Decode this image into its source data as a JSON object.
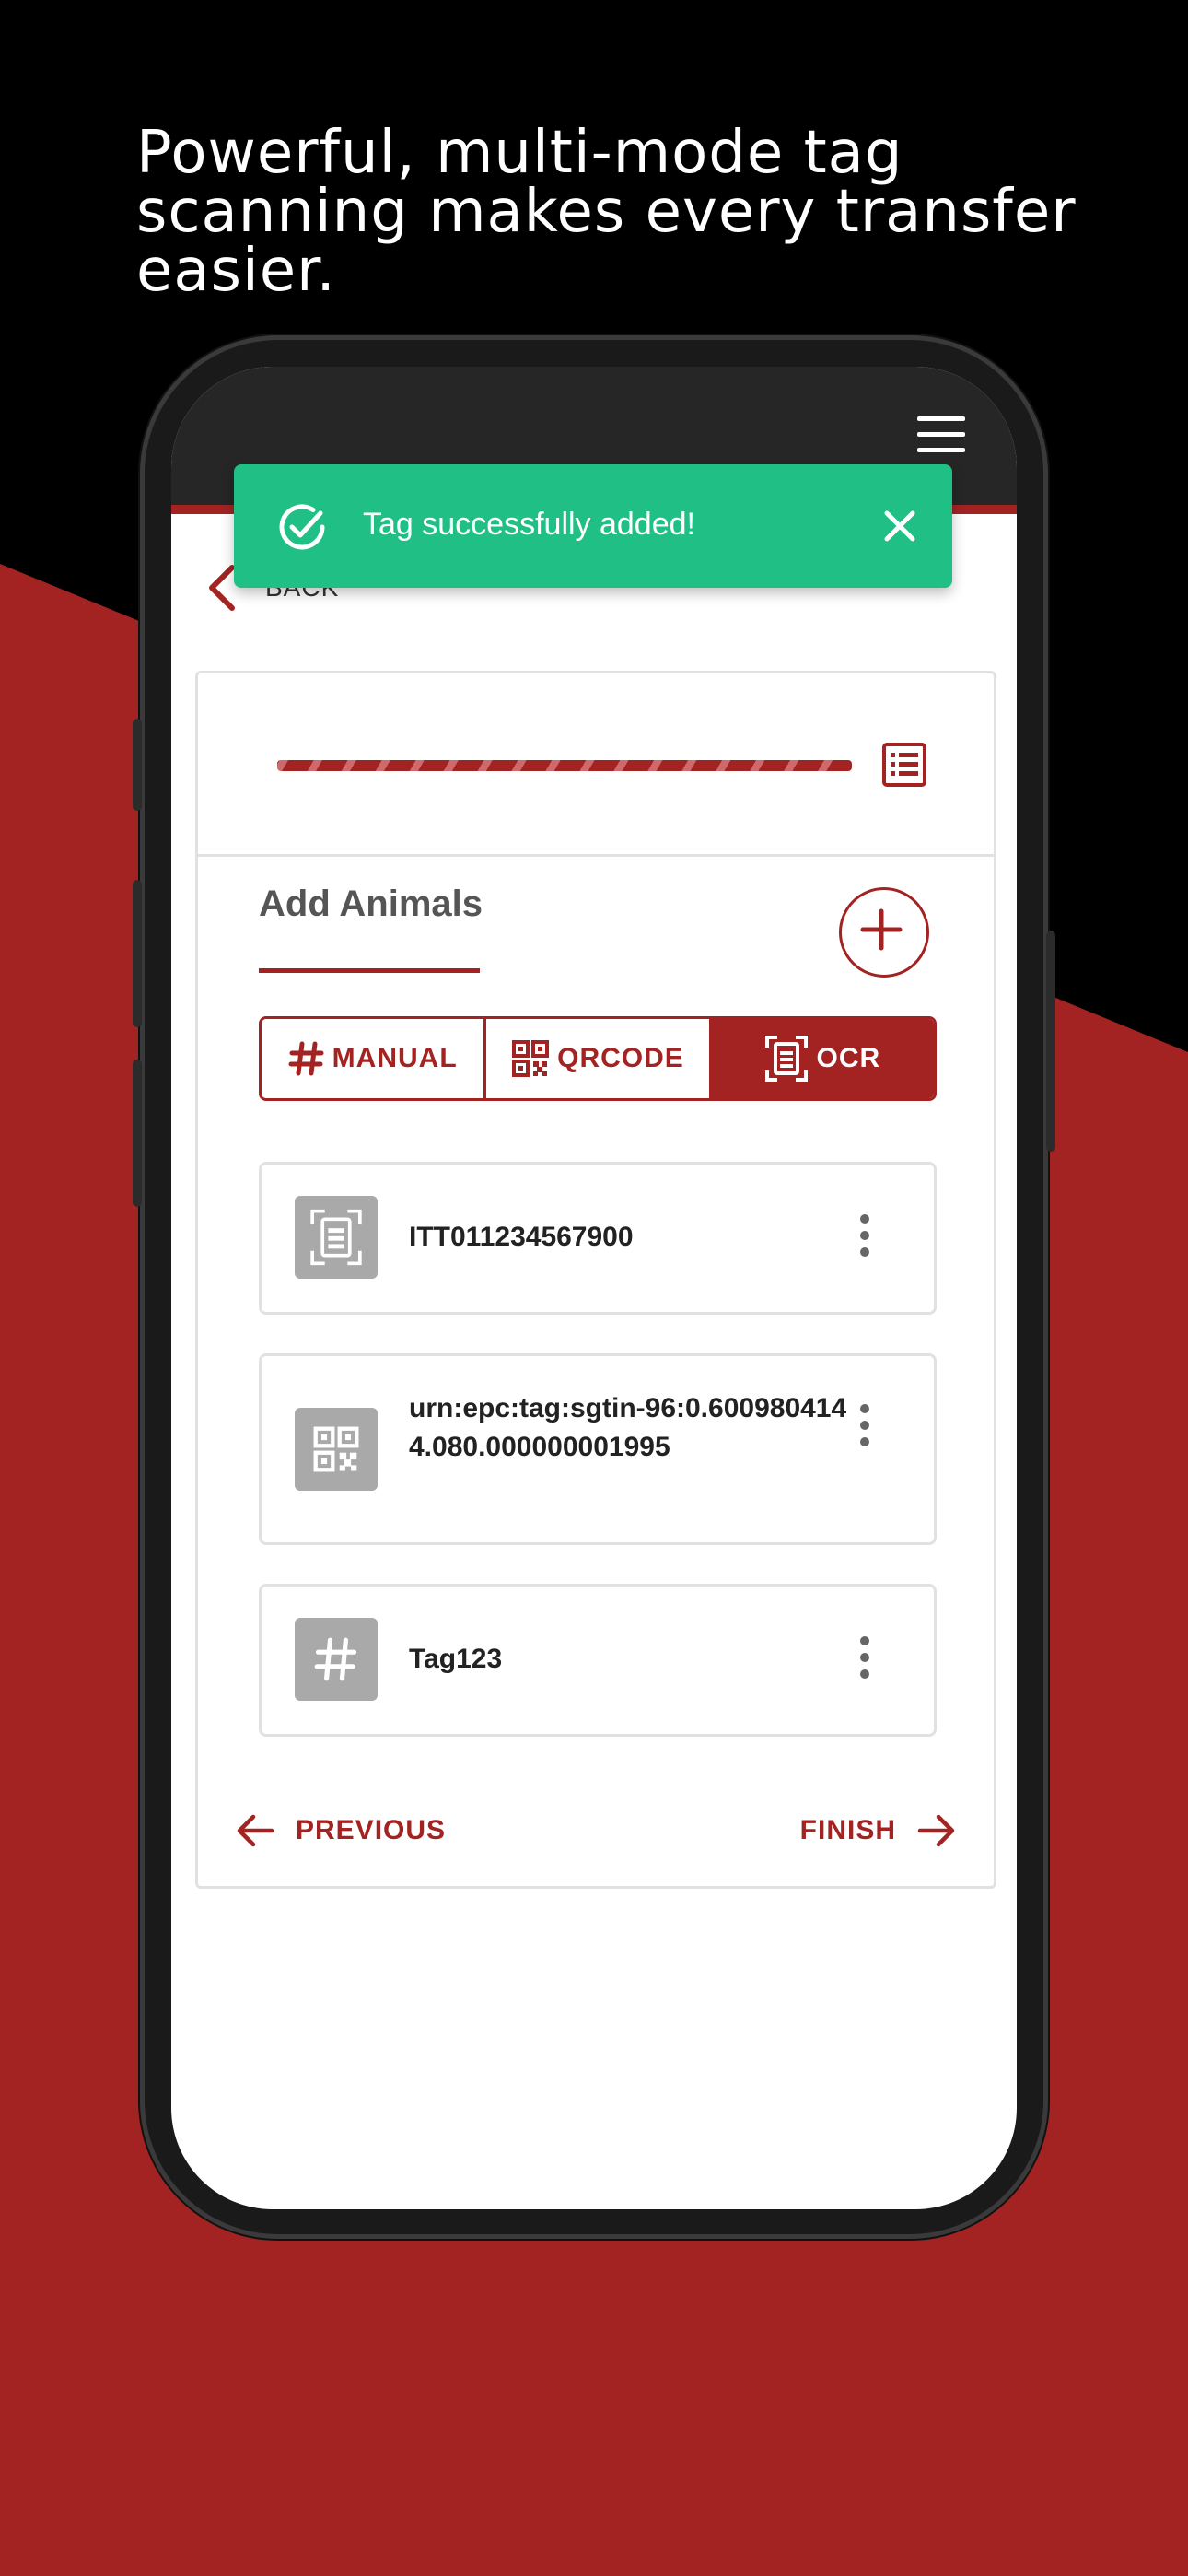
{
  "headline": "Powerful, multi-mode tag scanning makes every transfer easier.",
  "colors": {
    "brand_red": "#a32323",
    "toast_green": "#1fbf86",
    "appbar_dark": "#262626",
    "background_black": "#000000"
  },
  "appbar": {
    "menu_icon": "hamburger-menu-icon"
  },
  "back": {
    "label": "BACK"
  },
  "toast": {
    "message": "Tag successfully added!",
    "icon": "check-circle-icon",
    "close_icon": "close-icon"
  },
  "progress": {
    "icon": "list-icon"
  },
  "section": {
    "title": "Add Animals",
    "add_icon": "plus-icon"
  },
  "modes": [
    {
      "label": "MANUAL",
      "icon": "hash-icon",
      "active": false
    },
    {
      "label": "QRCODE",
      "icon": "qrcode-icon",
      "active": false
    },
    {
      "label": "OCR",
      "icon": "ocr-scan-icon",
      "active": true
    }
  ],
  "tags": [
    {
      "value": "ITT011234567900",
      "type_icon": "ocr-scan-icon"
    },
    {
      "value": "urn:epc:tag:sgtin-96:0.6009804144.080.000000001995",
      "type_icon": "qrcode-icon"
    },
    {
      "value": "Tag123",
      "type_icon": "hash-icon"
    }
  ],
  "nav": {
    "previous_label": "PREVIOUS",
    "finish_label": "FINISH"
  }
}
